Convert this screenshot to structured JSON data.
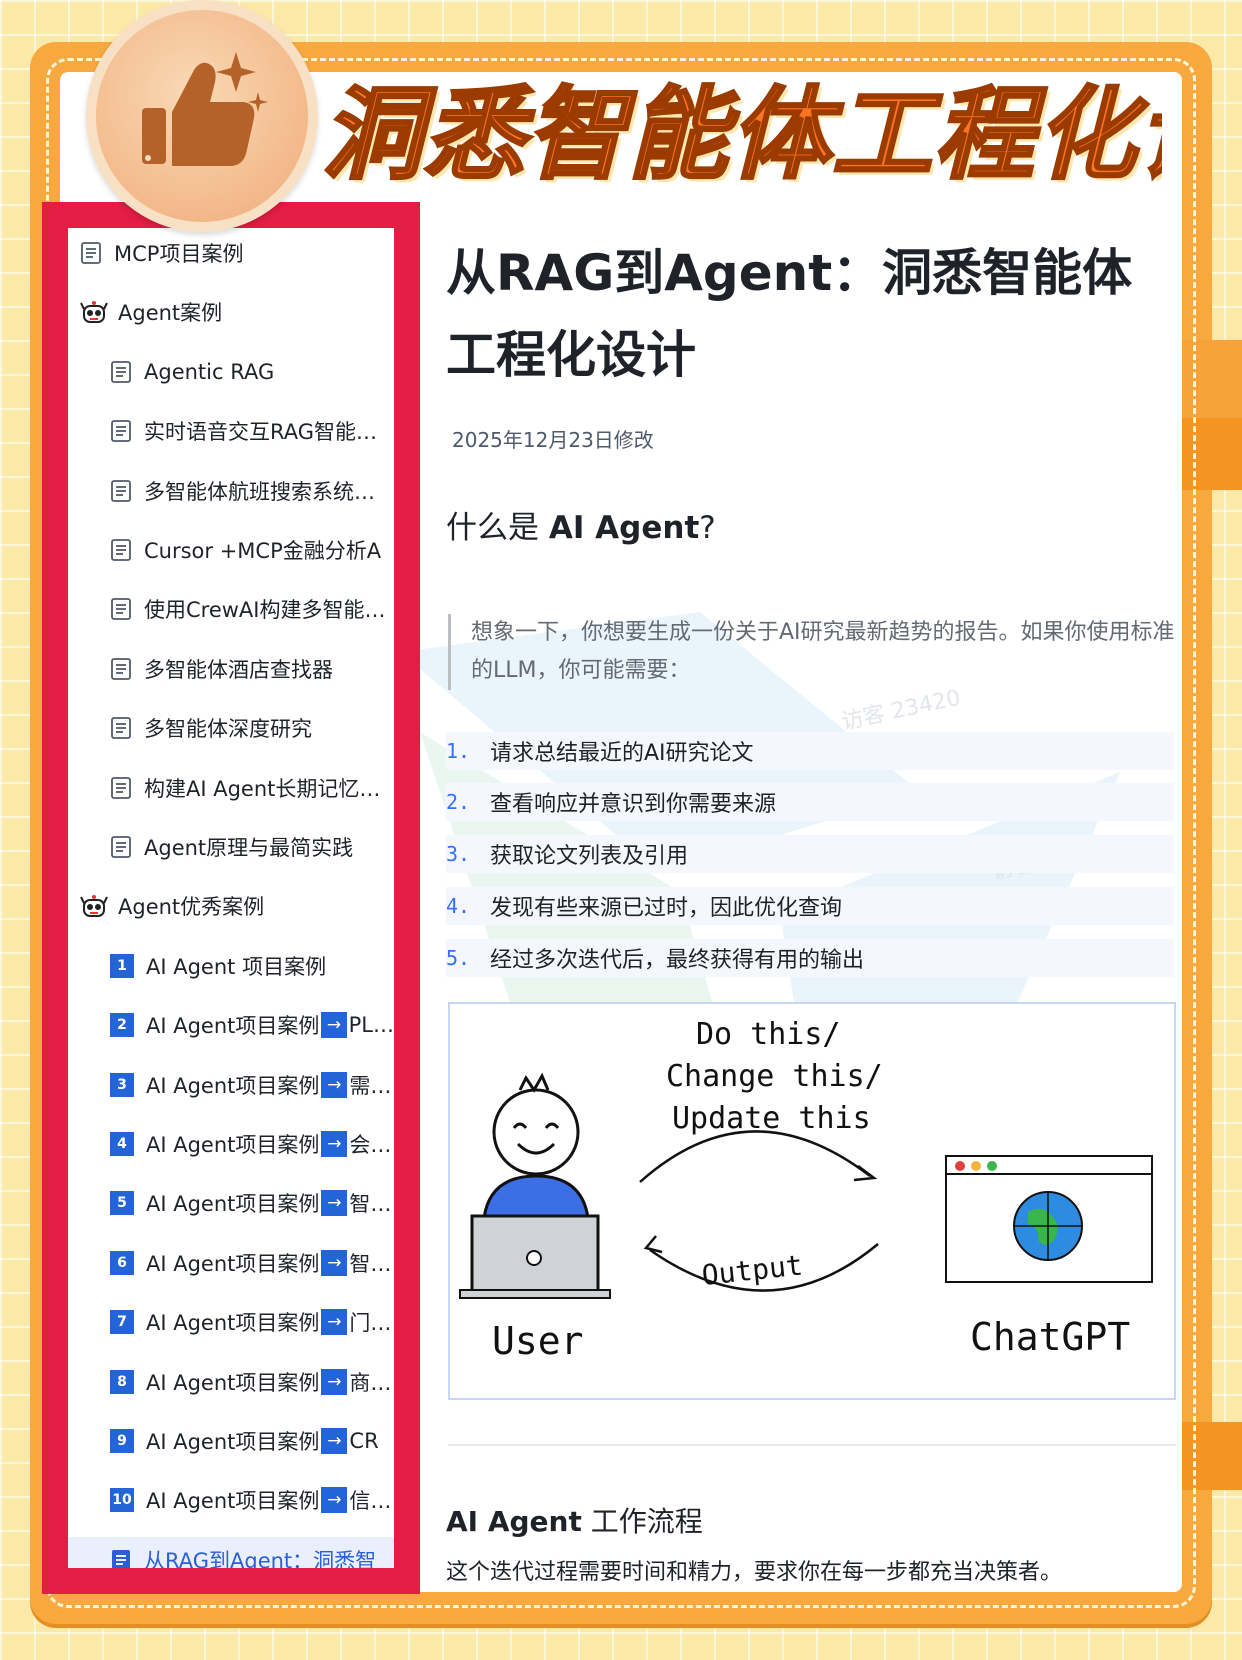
{
  "banner": {
    "title": "洞悉智能体工程化设计"
  },
  "sidebar": {
    "items": [
      {
        "label": "MCP项目案例",
        "icon": "doc-icon",
        "level": 0
      },
      {
        "label": "Agent案例",
        "icon": "robot-icon",
        "level": 0
      },
      {
        "label": "Agentic RAG",
        "icon": "doc-icon",
        "level": 1
      },
      {
        "label": "实时语音交互RAG智能…",
        "icon": "doc-icon",
        "level": 1
      },
      {
        "label": "多智能体航班搜索系统…",
        "icon": "doc-icon",
        "level": 1
      },
      {
        "label": "Cursor +MCP金融分析A",
        "icon": "doc-icon",
        "level": 1
      },
      {
        "label": "使用CrewAI构建多智能…",
        "icon": "doc-icon",
        "level": 1
      },
      {
        "label": "多智能体酒店查找器",
        "icon": "doc-icon",
        "level": 1
      },
      {
        "label": "多智能体深度研究",
        "icon": "doc-icon",
        "level": 1
      },
      {
        "label": "构建AI Agent长期记忆…",
        "icon": "doc-icon",
        "level": 1
      },
      {
        "label": "Agent原理与最简实践",
        "icon": "doc-icon",
        "level": 1
      },
      {
        "label": "Agent优秀案例",
        "icon": "robot-icon",
        "level": 0
      }
    ],
    "numbered": [
      {
        "num": "1",
        "label": "AI Agent 项目案例",
        "suffix": ""
      },
      {
        "num": "2",
        "label": "AI Agent项目案例",
        "suffix": "PL…"
      },
      {
        "num": "3",
        "label": "AI Agent项目案例",
        "suffix": "需…"
      },
      {
        "num": "4",
        "label": "AI Agent项目案例",
        "suffix": "会…"
      },
      {
        "num": "5",
        "label": "AI Agent项目案例",
        "suffix": "智…"
      },
      {
        "num": "6",
        "label": "AI Agent项目案例",
        "suffix": "智…"
      },
      {
        "num": "7",
        "label": "AI Agent项目案例",
        "suffix": "门…"
      },
      {
        "num": "8",
        "label": "AI Agent项目案例",
        "suffix": "商…"
      },
      {
        "num": "9",
        "label": "AI Agent项目案例",
        "suffix": "CR"
      },
      {
        "num": "10",
        "label": "AI Agent项目案例",
        "suffix": "信…"
      }
    ],
    "active_item": "从RAG到Agent：洞悉智"
  },
  "article": {
    "title_line1": "从RAG到Agent：洞悉智能体",
    "title_line2": "工程化设计",
    "modified": "2025年12月23日修改",
    "section1_prefix": "什么是 ",
    "section1_bold": "AI Agent",
    "section1_suffix": "?",
    "quote": "想象一下，你想要生成一份关于AI研究最新趋势的报告。如果你使用标准的LLM，你可能需要：",
    "steps": [
      {
        "n": "1.",
        "text": "请求总结最近的AI研究论文"
      },
      {
        "n": "2.",
        "text": "查看响应并意识到你需要来源"
      },
      {
        "n": "3.",
        "text": "获取论文列表及引用"
      },
      {
        "n": "4.",
        "text": "发现有些来源已过时，因此优化查询"
      },
      {
        "n": "5.",
        "text": "经过多次迭代后，最终获得有用的输出"
      }
    ],
    "diagram": {
      "line1": "Do this/",
      "line2": "Change this/",
      "line3": "Update this",
      "output": "Output",
      "user": "User",
      "chatgpt": "ChatGPT"
    },
    "section2_bold": "AI Agent",
    "section2_suffix": " 工作流程",
    "body": "这个迭代过程需要时间和精力，要求你在每一步都充当决策者。"
  },
  "watermark": "访客 23420",
  "colors": {
    "accent": "#3370ff",
    "sidebar_border": "#e31d45",
    "frame": "#f7a93f",
    "title": "#fb7420"
  }
}
